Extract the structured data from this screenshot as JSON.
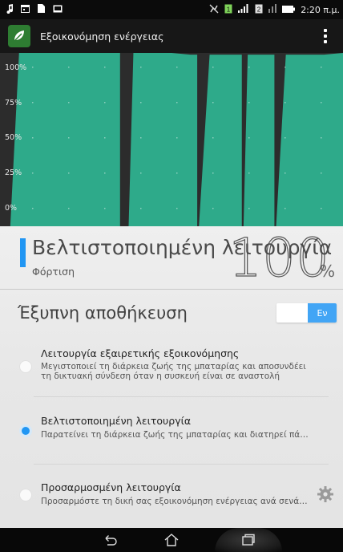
{
  "status_bar": {
    "left_icons": [
      "music-note-icon",
      "calendar-icon",
      "document-icon",
      "image-icon"
    ],
    "right_icons": [
      "mute-icon",
      "sim-1-icon",
      "signal-icon",
      "sim-2-icon",
      "signal-2-icon",
      "battery-icon"
    ],
    "time": "2:20 π.μ."
  },
  "app": {
    "title": "Εξοικονόμηση ενέργειας"
  },
  "chart_data": {
    "type": "area",
    "y_ticks": [
      "100%",
      "75%",
      "50%",
      "25%",
      "0%"
    ],
    "ylim": [
      0,
      100
    ],
    "grid": true,
    "colors": {
      "fill": "#2eaa8a",
      "background": "#2c2c2c",
      "separator": "#262626"
    },
    "segments_x": [
      [
        0.03,
        0.35
      ],
      [
        0.375,
        0.575
      ],
      [
        0.58,
        0.705
      ],
      [
        0.71,
        0.8
      ],
      [
        0.805,
        1.0
      ]
    ],
    "series": [
      {
        "values": [
          100,
          100,
          100,
          100,
          100,
          100,
          100,
          100,
          100,
          100,
          99,
          99,
          99,
          99,
          99,
          99,
          99,
          99,
          100
        ]
      }
    ]
  },
  "battery": {
    "mode_title": "Βελτιστοποιημένη λειτουργία",
    "state": "Φόρτιση",
    "percent": "100",
    "percent_sign": "%"
  },
  "smart_saving": {
    "title": "Έξυπνη αποθήκευση",
    "toggle_label": "Εν"
  },
  "options": [
    {
      "title": "Λειτουργία εξαιρετικής εξοικονόμησης",
      "description": "Μεγιστοποιεί τη διάρκεια ζωής της μπαταρίας και αποσυνδέει τη δικτυακή σύνδεση όταν η συσκευή είναι σε αναστολή",
      "selected": false
    },
    {
      "title": "Βελτιστοποιημένη λειτουργία",
      "description": "Παρατείνει τη διάρκεια ζωής της μπαταρίας και διατηρεί πάντα συνδεδεμένο το δίκτυο",
      "selected": true
    },
    {
      "title": "Προσαρμοσμένη λειτουργία",
      "description": "Προσαρμόστε τη δική σας εξοικονόμηση ενέργειας ανά σενάριο",
      "selected": false
    }
  ],
  "nav": {
    "icons": [
      "back-icon",
      "home-icon",
      "recents-icon"
    ]
  }
}
